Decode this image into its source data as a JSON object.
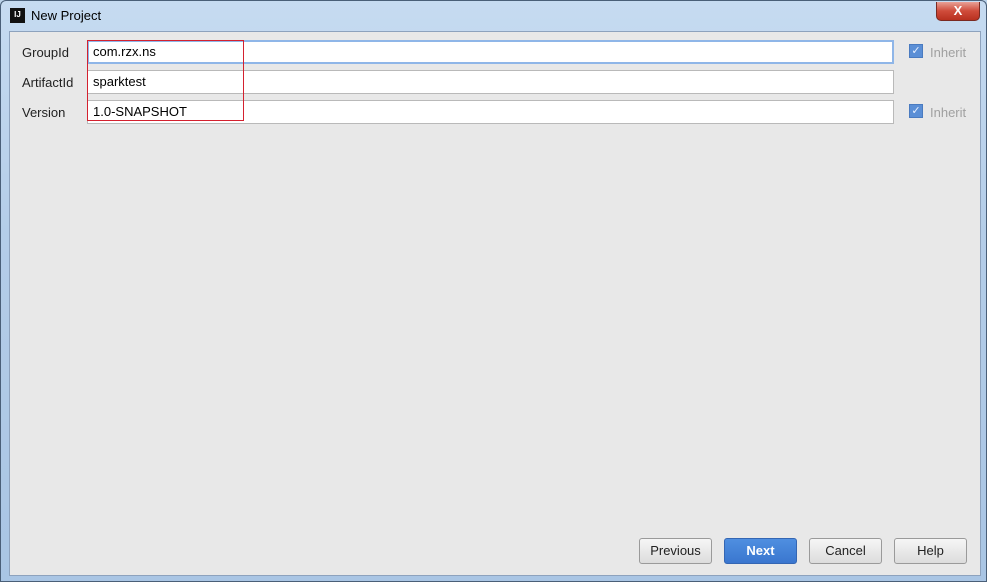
{
  "window": {
    "title": "New Project",
    "icon": "intellij-icon",
    "close_label": "X"
  },
  "form": {
    "group_id": {
      "label": "GroupId",
      "value": "com.rzx.ns",
      "inherit_label": "Inherit",
      "inherit_checked": true
    },
    "artifact_id": {
      "label": "ArtifactId",
      "value": "sparktest"
    },
    "version": {
      "label": "Version",
      "value": "1.0-SNAPSHOT",
      "inherit_label": "Inherit",
      "inherit_checked": true
    }
  },
  "buttons": {
    "previous": "Previous",
    "next": "Next",
    "cancel": "Cancel",
    "help": "Help"
  },
  "colors": {
    "highlight_box": "#d4212f",
    "primary_button": "#3a76cf"
  }
}
